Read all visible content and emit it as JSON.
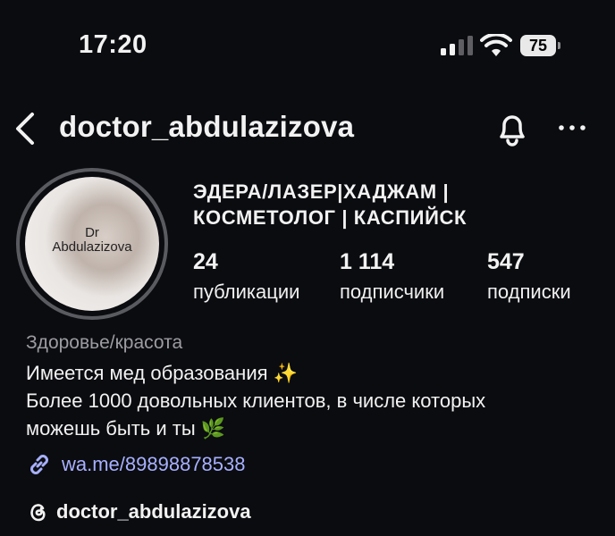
{
  "status_bar": {
    "time": "17:20",
    "battery": "75",
    "icons": [
      "signal-icon",
      "wifi-icon",
      "battery-icon"
    ]
  },
  "header": {
    "username": "doctor_abdulazizova",
    "icons": [
      "back-arrow-icon",
      "bell-icon",
      "more-icon"
    ]
  },
  "avatar": {
    "line1": "Dr",
    "line2": "Abdulazizova"
  },
  "profile": {
    "name_line1": "ЭДЕРА/ЛАЗЕР|ХАДЖАМ |",
    "name_line2": "КОСМЕТОЛОГ | КАСПИЙСК"
  },
  "stats": [
    {
      "value": "24",
      "label": "публикации"
    },
    {
      "value": "1 114",
      "label": "подписчики"
    },
    {
      "value": "547",
      "label": "подписки"
    }
  ],
  "bio": {
    "category": "Здоровье/красота",
    "line1": "Имеется мед образования ✨",
    "line2": "Более 1000 довольных клиентов, в числе которых",
    "line3": "можешь быть и ты 🌿",
    "link": "wa.me/89898878538",
    "threads": "doctor_abdulazizova"
  },
  "colors": {
    "background": "#0b0c10",
    "link": "#a7b0ff",
    "muted": "#9c9ca2"
  }
}
